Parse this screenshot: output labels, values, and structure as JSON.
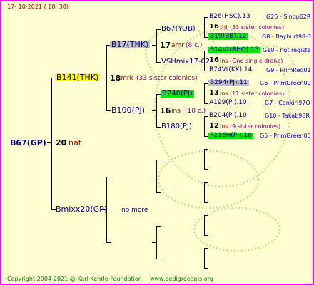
{
  "header": {
    "date": "17-  10-2021  (  18:  38)"
  },
  "footer": {
    "copyright": "Copyright 2004-2021 @ Karl Kehrle Foundation",
    "site": "www.pedigreeapis.org"
  },
  "colors": {
    "border": "#ff00ff",
    "background": "#ffffd2",
    "highlight_yellow": "#ffff00",
    "highlight_green": "#00e600",
    "highlight_gray": "#c0c0c0"
  },
  "gen0": {
    "name": "B67(GP)",
    "num": "20",
    "tag": "nat"
  },
  "gen1": [
    {
      "name": "B141(THK)",
      "num": "18",
      "tag": "mrk",
      "note": "(33 sister colonies)"
    },
    {
      "name": "Bmixx20(GP)",
      "note": "no more"
    }
  ],
  "gen2": [
    {
      "name": "B17(THK)",
      "num": "17",
      "tag": "amr",
      "note": "(8 c.)"
    },
    {
      "name": "B100(PJ)",
      "num": "16",
      "tag": "ins",
      "note": "(10 c.)"
    }
  ],
  "gen3": [
    {
      "name": "B67(YOB)"
    },
    {
      "name": "VSHmix17-02",
      "num": "16",
      "tag": "ins",
      "note": "(One single drone)"
    },
    {
      "name": "B240(PJ)",
      "num": "12",
      "tag": "ins",
      "note": "(9 sister colonies)"
    },
    {
      "name": "B180(PJ)"
    }
  ],
  "gen4": [
    {
      "name": "B26(HSC).13",
      "loc": "G26 - Sinop62R",
      "num": "16",
      "tag": "thl",
      "note": "(33 sister colonies)"
    },
    {
      "name": "B19(BB).12",
      "loc": "G8 - Bayburt98-3"
    },
    {
      "name": "B14Vt(RHO).13",
      "loc": "G10 - not registe"
    },
    {
      "name": "B74Vt(KK).14",
      "loc": "G9 - PrimRed01"
    },
    {
      "name": "B294(PJ).11",
      "loc": "G6 - PrimGreen00",
      "num": "13",
      "tag": "ins",
      "note": "(11 sister colonies)"
    },
    {
      "name": "A199(PJ).10",
      "loc": "G7 - Cankiri97Q"
    },
    {
      "name": "B204(PJ).10",
      "loc": "G10 - Takab93R"
    },
    {
      "name": "P216H(PJ).10",
      "loc": "G5 - PrimGreen00"
    }
  ]
}
